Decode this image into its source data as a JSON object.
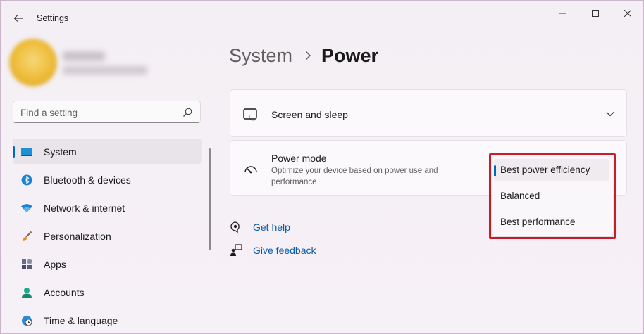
{
  "window": {
    "title": "Settings",
    "controls": {
      "minimize": "—",
      "maximize": "□",
      "close": "✕"
    }
  },
  "search": {
    "placeholder": "Find a setting"
  },
  "sidebar": {
    "items": [
      {
        "label": "System",
        "icon": "system-icon",
        "active": true
      },
      {
        "label": "Bluetooth & devices",
        "icon": "bluetooth-icon"
      },
      {
        "label": "Network & internet",
        "icon": "wifi-icon"
      },
      {
        "label": "Personalization",
        "icon": "brush-icon"
      },
      {
        "label": "Apps",
        "icon": "apps-icon"
      },
      {
        "label": "Accounts",
        "icon": "accounts-icon"
      },
      {
        "label": "Time & language",
        "icon": "globe-clock-icon"
      }
    ]
  },
  "breadcrumb": {
    "parent": "System",
    "current": "Power"
  },
  "cards": {
    "screen_sleep": {
      "title": "Screen and sleep",
      "icon": "screen-sleep-icon"
    },
    "power_mode": {
      "title": "Power mode",
      "description": "Optimize your device based on power use and performance",
      "icon": "gauge-icon"
    }
  },
  "power_mode_dropdown": {
    "options": [
      "Best power efficiency",
      "Balanced",
      "Best performance"
    ],
    "selected": "Best power efficiency",
    "highlight_color": "#c8202a"
  },
  "links": {
    "help": "Get help",
    "feedback": "Give feedback"
  },
  "colors": {
    "accent": "#0067c0",
    "link": "#0a5aa8"
  }
}
